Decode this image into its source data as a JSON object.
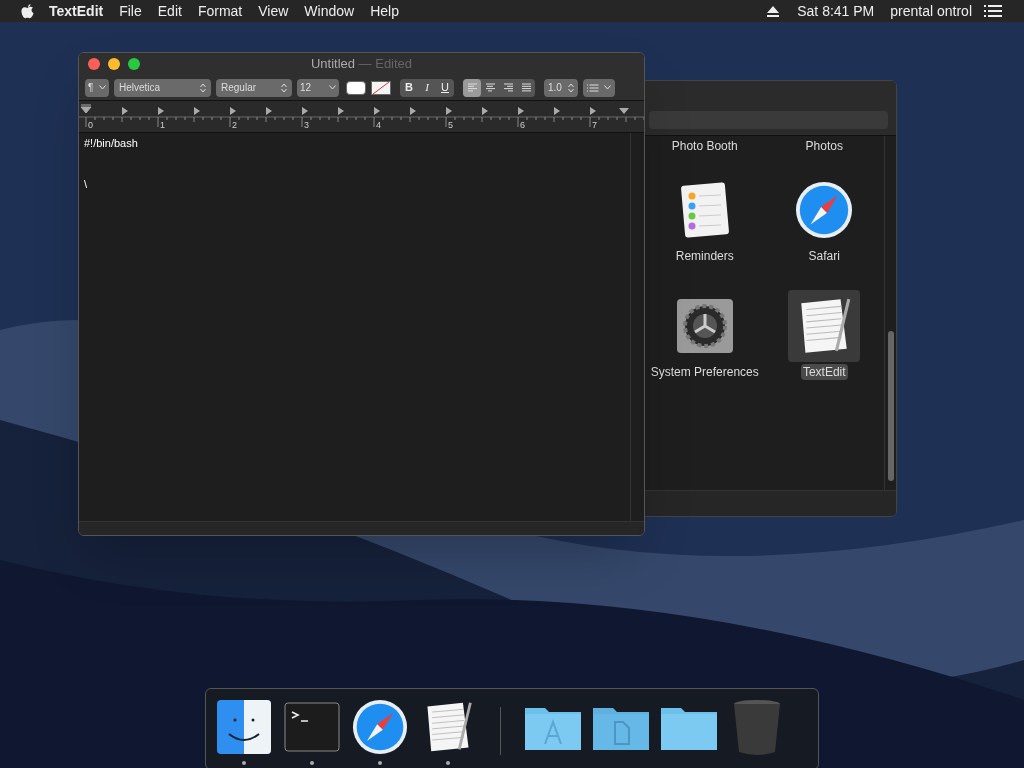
{
  "menu_bar": {
    "app": "TextEdit",
    "items": [
      "File",
      "Edit",
      "Format",
      "View",
      "Window",
      "Help"
    ],
    "clock": "Sat 8:41 PM",
    "user": "prental ontrol"
  },
  "editor": {
    "title": "Untitled",
    "status": "— Edited",
    "toolbar": {
      "paragraph": "¶",
      "font": "Helvetica",
      "style": "Regular",
      "size": "12",
      "spacing": "1.0",
      "format_buttons": [
        {
          "label": "B",
          "kind": "bold",
          "selected": false
        },
        {
          "label": "I",
          "kind": "italic",
          "selected": false
        },
        {
          "label": "U",
          "kind": "underline",
          "selected": false
        }
      ],
      "alignments": [
        {
          "kind": "left",
          "selected": true
        },
        {
          "kind": "center",
          "selected": false
        },
        {
          "kind": "right",
          "selected": false
        },
        {
          "kind": "justify",
          "selected": false
        }
      ]
    },
    "ruler": [
      "0",
      "1",
      "2",
      "3",
      "4",
      "5",
      "6",
      "7"
    ],
    "lines": [
      "#!/bin/bash",
      "\\"
    ]
  },
  "launcher": {
    "items": [
      {
        "label": "Photo Booth",
        "kind": "none",
        "selected": false
      },
      {
        "label": "Photos",
        "kind": "none",
        "selected": false
      },
      {
        "label": "Reminders",
        "kind": "reminders",
        "selected": false
      },
      {
        "label": "Safari",
        "kind": "safari",
        "selected": false
      },
      {
        "label": "System Preferences",
        "kind": "gear",
        "selected": false
      },
      {
        "label": "TextEdit",
        "kind": "textedit",
        "selected": true
      }
    ]
  },
  "dock": [
    {
      "kind": "finder",
      "running": true
    },
    {
      "kind": "terminal",
      "running": true
    },
    {
      "kind": "safari",
      "running": true
    },
    {
      "kind": "textedit",
      "running": true
    },
    {
      "kind": "divider",
      "running": false
    },
    {
      "kind": "apps-folder",
      "running": false
    },
    {
      "kind": "docs-folder",
      "running": false
    },
    {
      "kind": "folder",
      "running": false
    },
    {
      "kind": "trash",
      "running": false
    }
  ]
}
